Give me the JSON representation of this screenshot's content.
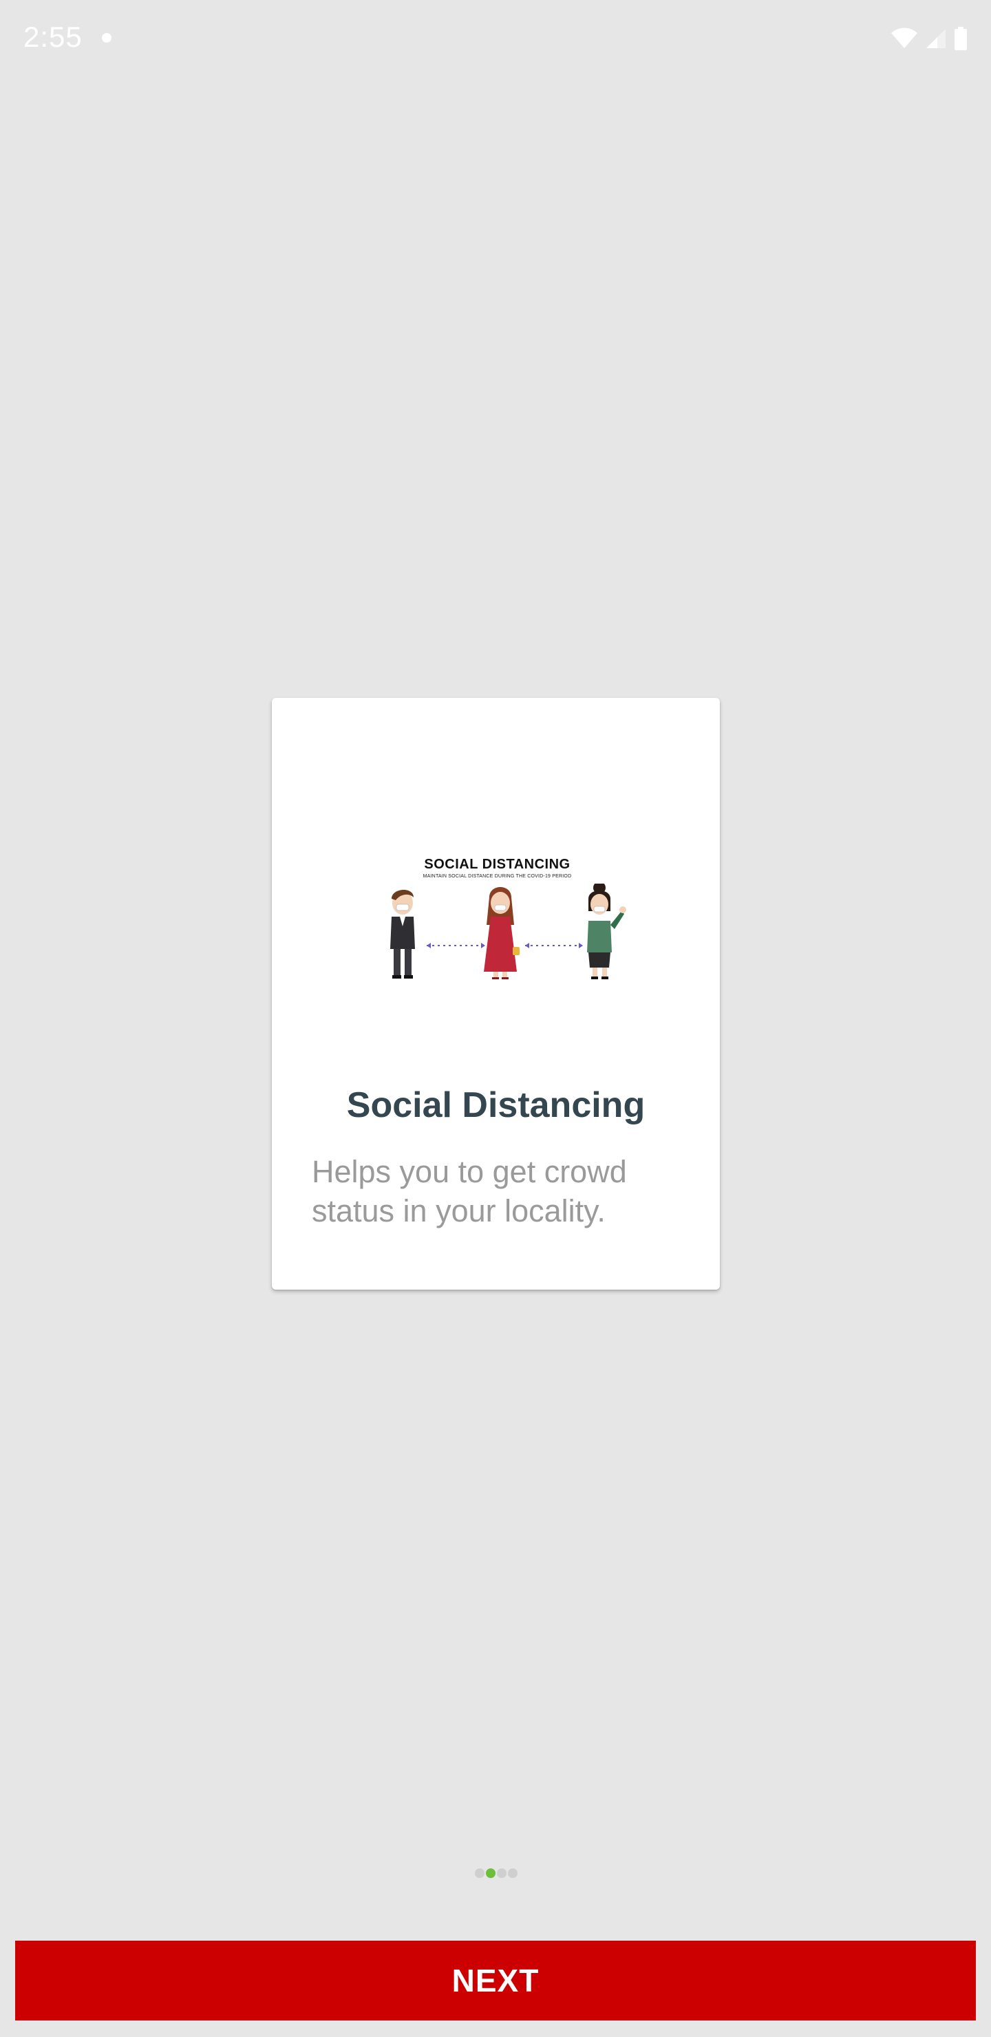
{
  "status_bar": {
    "time": "2:55",
    "icons": [
      "notification-dot-icon",
      "wifi-icon",
      "cell-signal-icon",
      "battery-icon"
    ]
  },
  "card": {
    "illustration": {
      "heading": "SOCIAL DISTANCING",
      "subheading": "MAINTAIN SOCIAL DISTANCE DURING THE COVID-19 PERIOD",
      "icon": "social-distancing-illustration"
    },
    "title": "Social Distancing",
    "description": "Helps you to get crowd status in your locality."
  },
  "page_indicator": {
    "total": 4,
    "active_index": 1
  },
  "actions": {
    "next_label": "NEXT"
  },
  "colors": {
    "background": "#e6e6e6",
    "card": "#ffffff",
    "title": "#344750",
    "description": "#9a9a9a",
    "button": "#cc0000",
    "indicator_active": "#6bbf3a",
    "indicator_inactive": "#cfcfcf"
  }
}
